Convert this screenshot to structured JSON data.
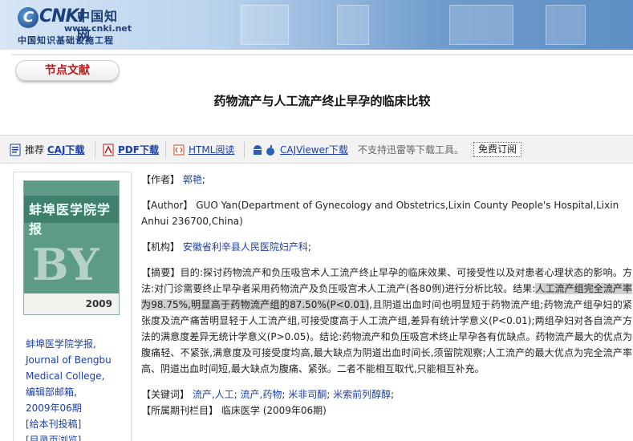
{
  "header": {
    "logo_cnki": "CNKI",
    "logo_cn": "中国知网",
    "logo_url": "www.cnki.net",
    "logo_sub": "中国知识基础设施工程"
  },
  "section_pill": "节点文献",
  "doc_title": "药物流产与人工流产终止早孕的临床比较",
  "toolbar": {
    "recommend": "推荐",
    "caj": "CAJ下载",
    "pdf": "PDF下载",
    "html": "HTML阅读",
    "cajviewer": "CAJViewer下载",
    "notice": "不支持迅雷等下载工具。",
    "subscribe": "免费订阅"
  },
  "journal": {
    "cover_title": "蚌埠医学院学报",
    "cover_year": "2009",
    "name": "蚌埠医学院学报",
    "name_en": "Journal of Bengbu Medical College",
    "dept": "编辑部邮箱",
    "issue": "2009年06期",
    "submit": "[给本刊投稿]",
    "browse": "[目录页浏览]"
  },
  "meta": {
    "author_label": "【作者】",
    "author": "郭艳",
    "author_en_label": "【Author】",
    "author_en": "GUO Yan(Department of Gynecology and Obstetrics,Lixin County People's Hospital,Lixin Anhui 236700,China)",
    "org_label": "【机构】",
    "org": "安徽省利辛县人民医院妇产科",
    "abstract_label": "【摘要】",
    "abstract_a": "目的:探讨药物流产和负压吸宫术人工流产终止早孕的临床效果、可接受性以及对患者心理状态的影响。方法:对门诊需要终止早孕者采用药物流产及负压吸宫术人工流产(各80例)进行分析比较。结果:",
    "abstract_hl": "人工流产组完全流产率为98.75%,明显高于药物流产组的87.50%(P<0.01)",
    "abstract_b": ",且阴道出血时间也明显短于药物流产组;药物流产组孕妇的紧张度及流产痛苦明显轻于人工流产组,可接受度高于人工流产组,差异有统计学意义(P<0.01);两组孕妇对各自流产方法的满意度差异无统计学意义(P>0.05)。结论:药物流产和负压吸宫术终止早孕各有优缺点。药物流产最大的优点为腹痛轻、不紧张,满意度及可接受度均高,最大缺点为阴道出血时间长,须留院观察;人工流产的最大优点为完全流产率高、阴道出血时间短,最大缺点为腹痛、紧张。二者不能相互取代,只能相互补充。",
    "keywords_label": "【关键词】",
    "keywords": [
      "流产,人工",
      "流产,药物",
      "米非司酮",
      "米索前列醇醇"
    ],
    "column_label": "【所属期刊栏目】",
    "column": "临床医学",
    "column_issue": "(2009年06期)"
  }
}
